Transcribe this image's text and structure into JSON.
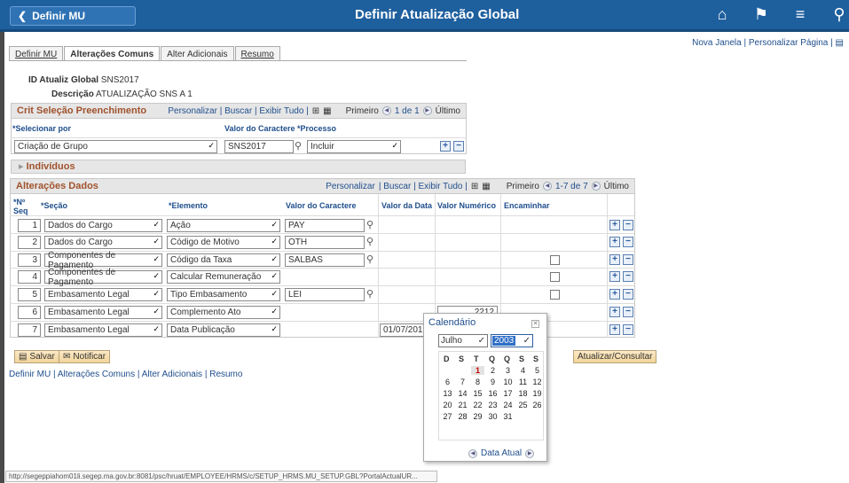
{
  "header": {
    "back_label": "Definir MU",
    "title": "Definir Atualização Global",
    "icons": [
      "home-icon",
      "flag-icon",
      "menu-icon",
      "compass-icon"
    ]
  },
  "top_links": {
    "new_window": "Nova Janela",
    "separator": "|",
    "personalize": "Personalizar Página",
    "separator2": "|"
  },
  "tabs": [
    "Definir MU",
    "Alterações Comuns",
    "Alter Adicionais",
    "Resumo"
  ],
  "info": {
    "id_label": "ID Atualiz Global",
    "id_value": "SNS2017",
    "desc_label": "Descrição",
    "desc_value": "ATUALIZAÇÃO SNS A 1"
  },
  "crit": {
    "title": "Crit Seleção Preenchimento",
    "nav": "Personalizar | Buscar | Exibir Tudo |",
    "first": "Primeiro",
    "range": "1 de 1",
    "last": "Último",
    "col_sel": "*Selecionar por",
    "col_val": "Valor do Caractere",
    "col_proc": "*Processo",
    "row": {
      "sel": "Criação de Grupo",
      "val": "SNS2017",
      "proc": "Incluir"
    }
  },
  "individuos": "Indivíduos",
  "alt": {
    "title": "Alterações Dados",
    "nav_pers": "Personalizar",
    "nav_rest": "| Buscar | Exibir Tudo |",
    "first": "Primeiro",
    "range": "1-7 de 7",
    "last": "Último",
    "cols": {
      "seq": "*Nº Seq",
      "secao": "*Seção",
      "elem": "*Elemento",
      "valc": "Valor do Caractere",
      "vald": "Valor da Data",
      "valn": "Valor Numérico",
      "enc": "Encaminhar"
    },
    "rows": [
      {
        "seq": "1",
        "secao": "Dados do Cargo",
        "elem": "Ação",
        "valc": "PAY",
        "vald": "",
        "valn": ""
      },
      {
        "seq": "2",
        "secao": "Dados do Cargo",
        "elem": "Código de Motivo",
        "valc": "OTH",
        "vald": "",
        "valn": ""
      },
      {
        "seq": "3",
        "secao": "Componentes de Pagamento",
        "elem": "Código da Taxa",
        "valc": "SALBAS",
        "vald": "",
        "valn": ""
      },
      {
        "seq": "4",
        "secao": "Componentes de Pagamento",
        "elem": "Calcular Remuneração",
        "valc": "",
        "vald": "",
        "valn": ""
      },
      {
        "seq": "5",
        "secao": "Embasamento Legal",
        "elem": "Tipo Embasamento",
        "valc": "LEI",
        "vald": "",
        "valn": ""
      },
      {
        "seq": "6",
        "secao": "Embasamento Legal",
        "elem": "Complemento Ato",
        "valc": "",
        "vald": "",
        "valn": "2212"
      },
      {
        "seq": "7",
        "secao": "Embasamento Legal",
        "elem": "Data Publicação",
        "valc": "",
        "vald": "01/07/2017",
        "valn": ""
      }
    ]
  },
  "buttons": {
    "save": "Salvar",
    "notify": "Notificar",
    "update": "Atualizar/Consultar"
  },
  "bottom_links": "Definir MU | Alterações Comuns | Alter Adicionais | Resumo",
  "status_url": "http://segeppiahom01li.segep.ma.gov.br:8081/psc/hruat/EMPLOYEE/HRMS/c/SETUP_HRMS.MU_SETUP.GBL?PortalActualUR...",
  "calendar": {
    "title": "Calendário",
    "month": "Julho",
    "year": "2003",
    "dow": [
      "D",
      "S",
      "T",
      "Q",
      "Q",
      "S",
      "S"
    ],
    "weeks": [
      [
        "",
        "",
        "1",
        "2",
        "3",
        "4",
        "5"
      ],
      [
        "6",
        "7",
        "8",
        "9",
        "10",
        "11",
        "12"
      ],
      [
        "13",
        "14",
        "15",
        "16",
        "17",
        "18",
        "19"
      ],
      [
        "20",
        "21",
        "22",
        "23",
        "24",
        "25",
        "26"
      ],
      [
        "27",
        "28",
        "29",
        "30",
        "31",
        "",
        ""
      ]
    ],
    "footer": "Data Atual"
  }
}
